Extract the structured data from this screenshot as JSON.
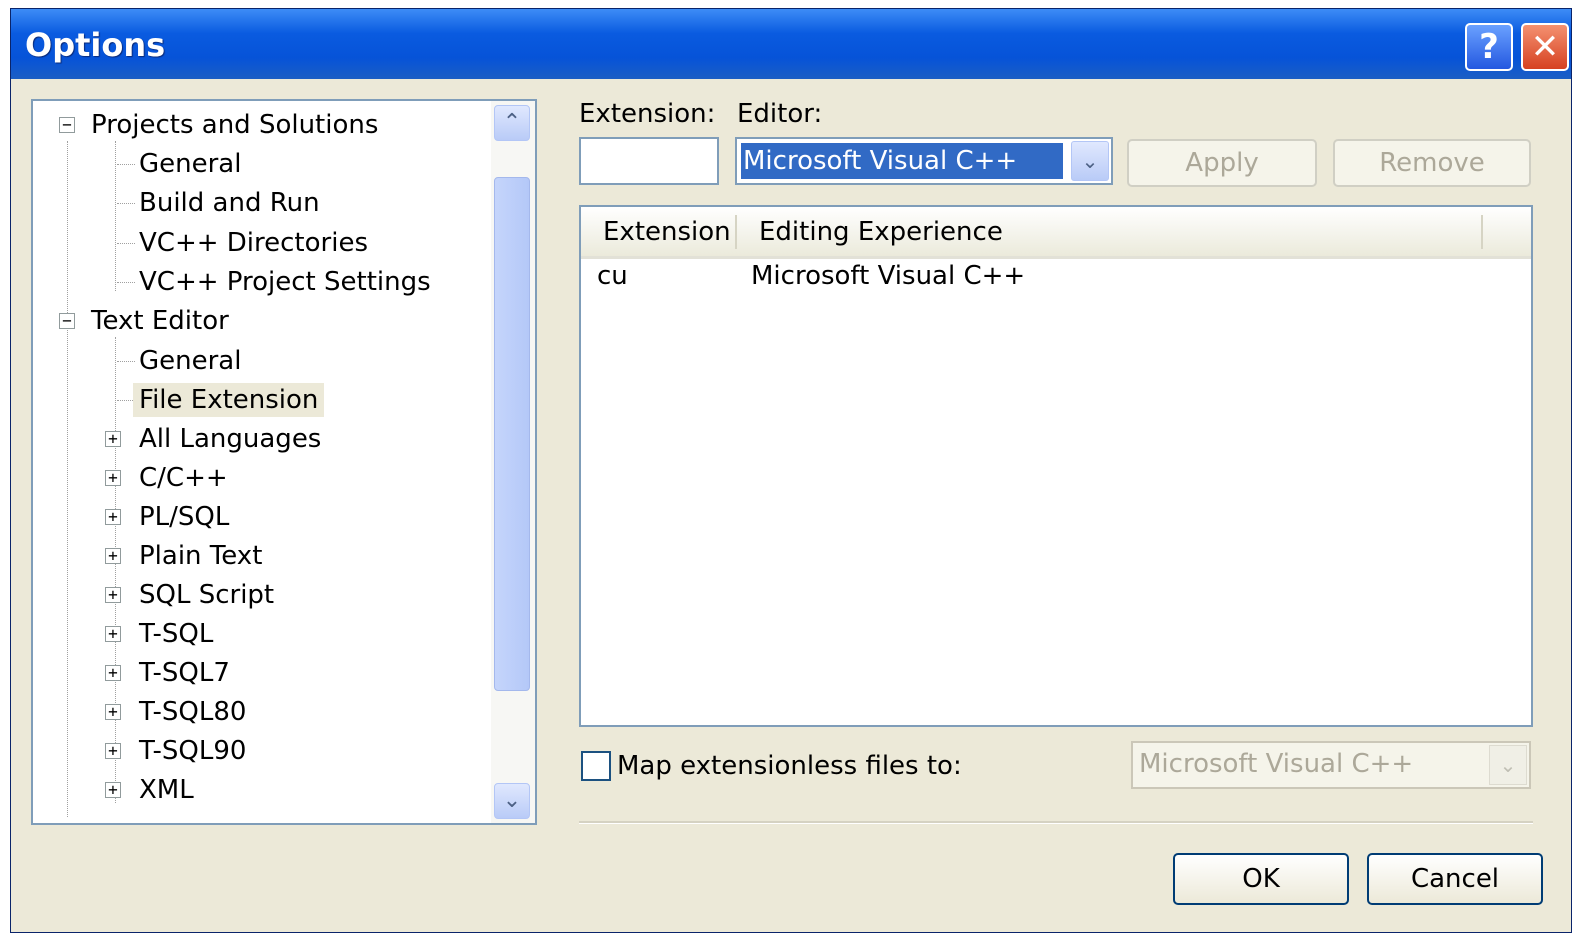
{
  "window": {
    "title": "Options",
    "help_label": "?",
    "close_label": "✕"
  },
  "tree": {
    "items": [
      {
        "label": "Projects and Solutions"
      },
      {
        "label": "General"
      },
      {
        "label": "Build and Run"
      },
      {
        "label": "VC++ Directories"
      },
      {
        "label": "VC++ Project Settings"
      },
      {
        "label": "Text Editor"
      },
      {
        "label": "General"
      },
      {
        "label": "File Extension"
      },
      {
        "label": "All Languages"
      },
      {
        "label": "C/C++"
      },
      {
        "label": "PL/SQL"
      },
      {
        "label": "Plain Text"
      },
      {
        "label": "SQL Script"
      },
      {
        "label": "T-SQL"
      },
      {
        "label": "T-SQL7"
      },
      {
        "label": "T-SQL80"
      },
      {
        "label": "T-SQL90"
      },
      {
        "label": "XML"
      }
    ],
    "collapse_glyph": "−",
    "expand_glyph": "+",
    "scroll_up_glyph": "⌃",
    "scroll_down_glyph": "⌄"
  },
  "extension": {
    "label": "Extension:",
    "value": ""
  },
  "editor": {
    "label": "Editor:",
    "value": "Microsoft Visual C++",
    "dropdown_glyph": "⌄"
  },
  "buttons": {
    "apply": "Apply",
    "remove": "Remove",
    "ok": "OK",
    "cancel": "Cancel"
  },
  "list": {
    "columns": [
      "Extension",
      "Editing Experience"
    ],
    "rows": [
      {
        "extension": "cu",
        "editing_experience": "Microsoft Visual C++"
      }
    ]
  },
  "map": {
    "label": "Map extensionless files to:",
    "checked": false,
    "value": "Microsoft Visual C++",
    "dropdown_glyph": "⌄"
  }
}
